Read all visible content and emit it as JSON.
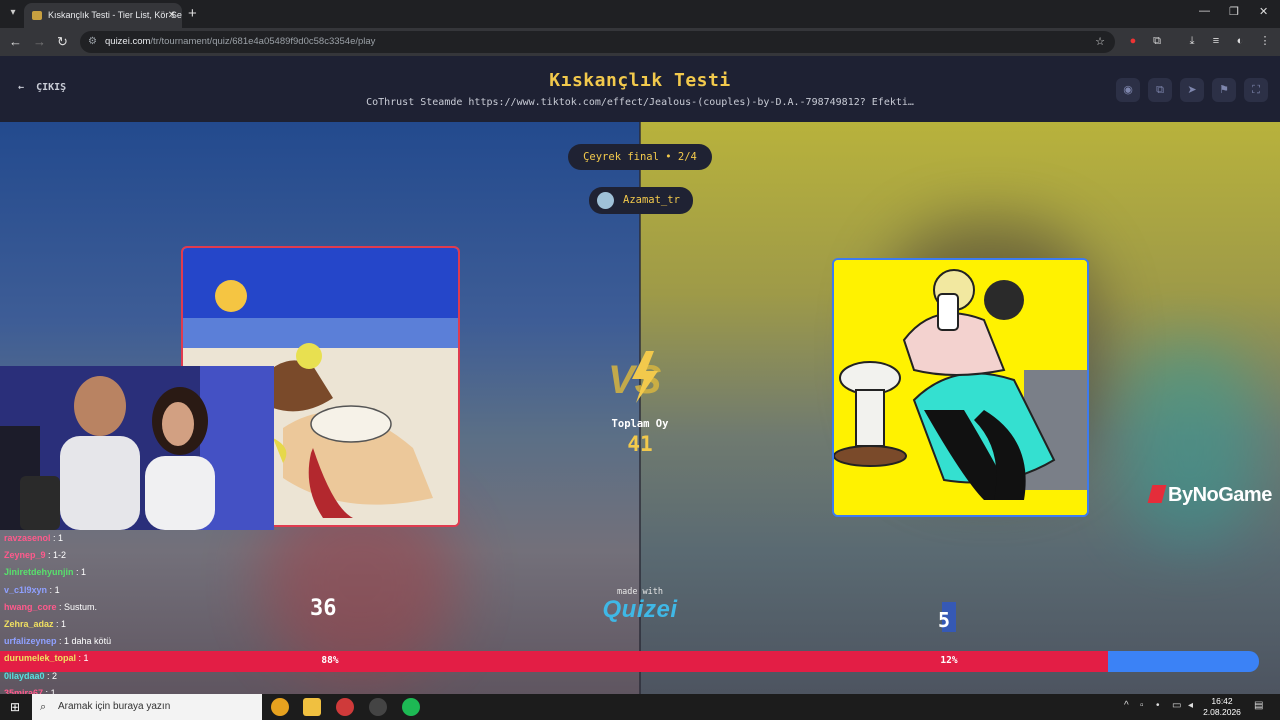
{
  "browser": {
    "tab_title": "Kıskançlık Testi - Tier List, Kör Se",
    "url_host": "quizei.com",
    "url_path": "/tr/tournament/quiz/681e4a05489f9d0c58c3354e/play"
  },
  "header": {
    "exit_label": "ÇIKIŞ",
    "title": "Kıskançlık Testi",
    "subtitle": "CoThrust Steamde https://www.tiktok.com/effect/Jealous-(couples)-by-D.A.-798749812? Efekti…"
  },
  "match": {
    "round": "Çeyrek final • 2/4",
    "user": "Azamat_tr",
    "total_label": "Toplam Oy",
    "total_value": "41",
    "left_score": "36",
    "right_score": "5",
    "left_pct_label": "88%",
    "right_pct_label": "12%",
    "left_fraction": 0.88,
    "right_fraction": 0.12
  },
  "branding": {
    "made_with": "made with",
    "logo": "Quizei",
    "sponsor": "ByNoGame"
  },
  "chat": [
    {
      "user": "ravzasenol",
      "msg": "1",
      "color": "#ff5a8c"
    },
    {
      "user": "Zeynep_9",
      "msg": "1-2",
      "color": "#ff5a8c"
    },
    {
      "user": "Jiniretdehyunjin",
      "msg": "1",
      "color": "#58e06c"
    },
    {
      "user": "v_c1l9xyn",
      "msg": "1",
      "color": "#8fa0ff"
    },
    {
      "user": "hwang_core",
      "msg": "Sustum.",
      "color": "#ff5a8c"
    },
    {
      "user": "Zehra_adaz",
      "msg": "1",
      "color": "#f0e060"
    },
    {
      "user": "urfalizeynep",
      "msg": "1 daha kötü",
      "color": "#8fa0ff"
    },
    {
      "user": "durumelek_topal",
      "msg": "1",
      "color": "#f0e060"
    },
    {
      "user": "0ilaydaa0",
      "msg": "2",
      "color": "#58e0e0"
    },
    {
      "user": "35mira67",
      "msg": "1",
      "color": "#ff5a8c"
    }
  ],
  "taskbar": {
    "search_placeholder": "Aramak için buraya yazın",
    "time": "16:42",
    "date": "2.08.2026"
  },
  "colors": {
    "accent": "#f2c94c",
    "left_bar": "#e31e45",
    "right_bar": "#3b82f6",
    "left_card_border": "#e03b4f",
    "right_card_border": "#3d7bf0"
  }
}
